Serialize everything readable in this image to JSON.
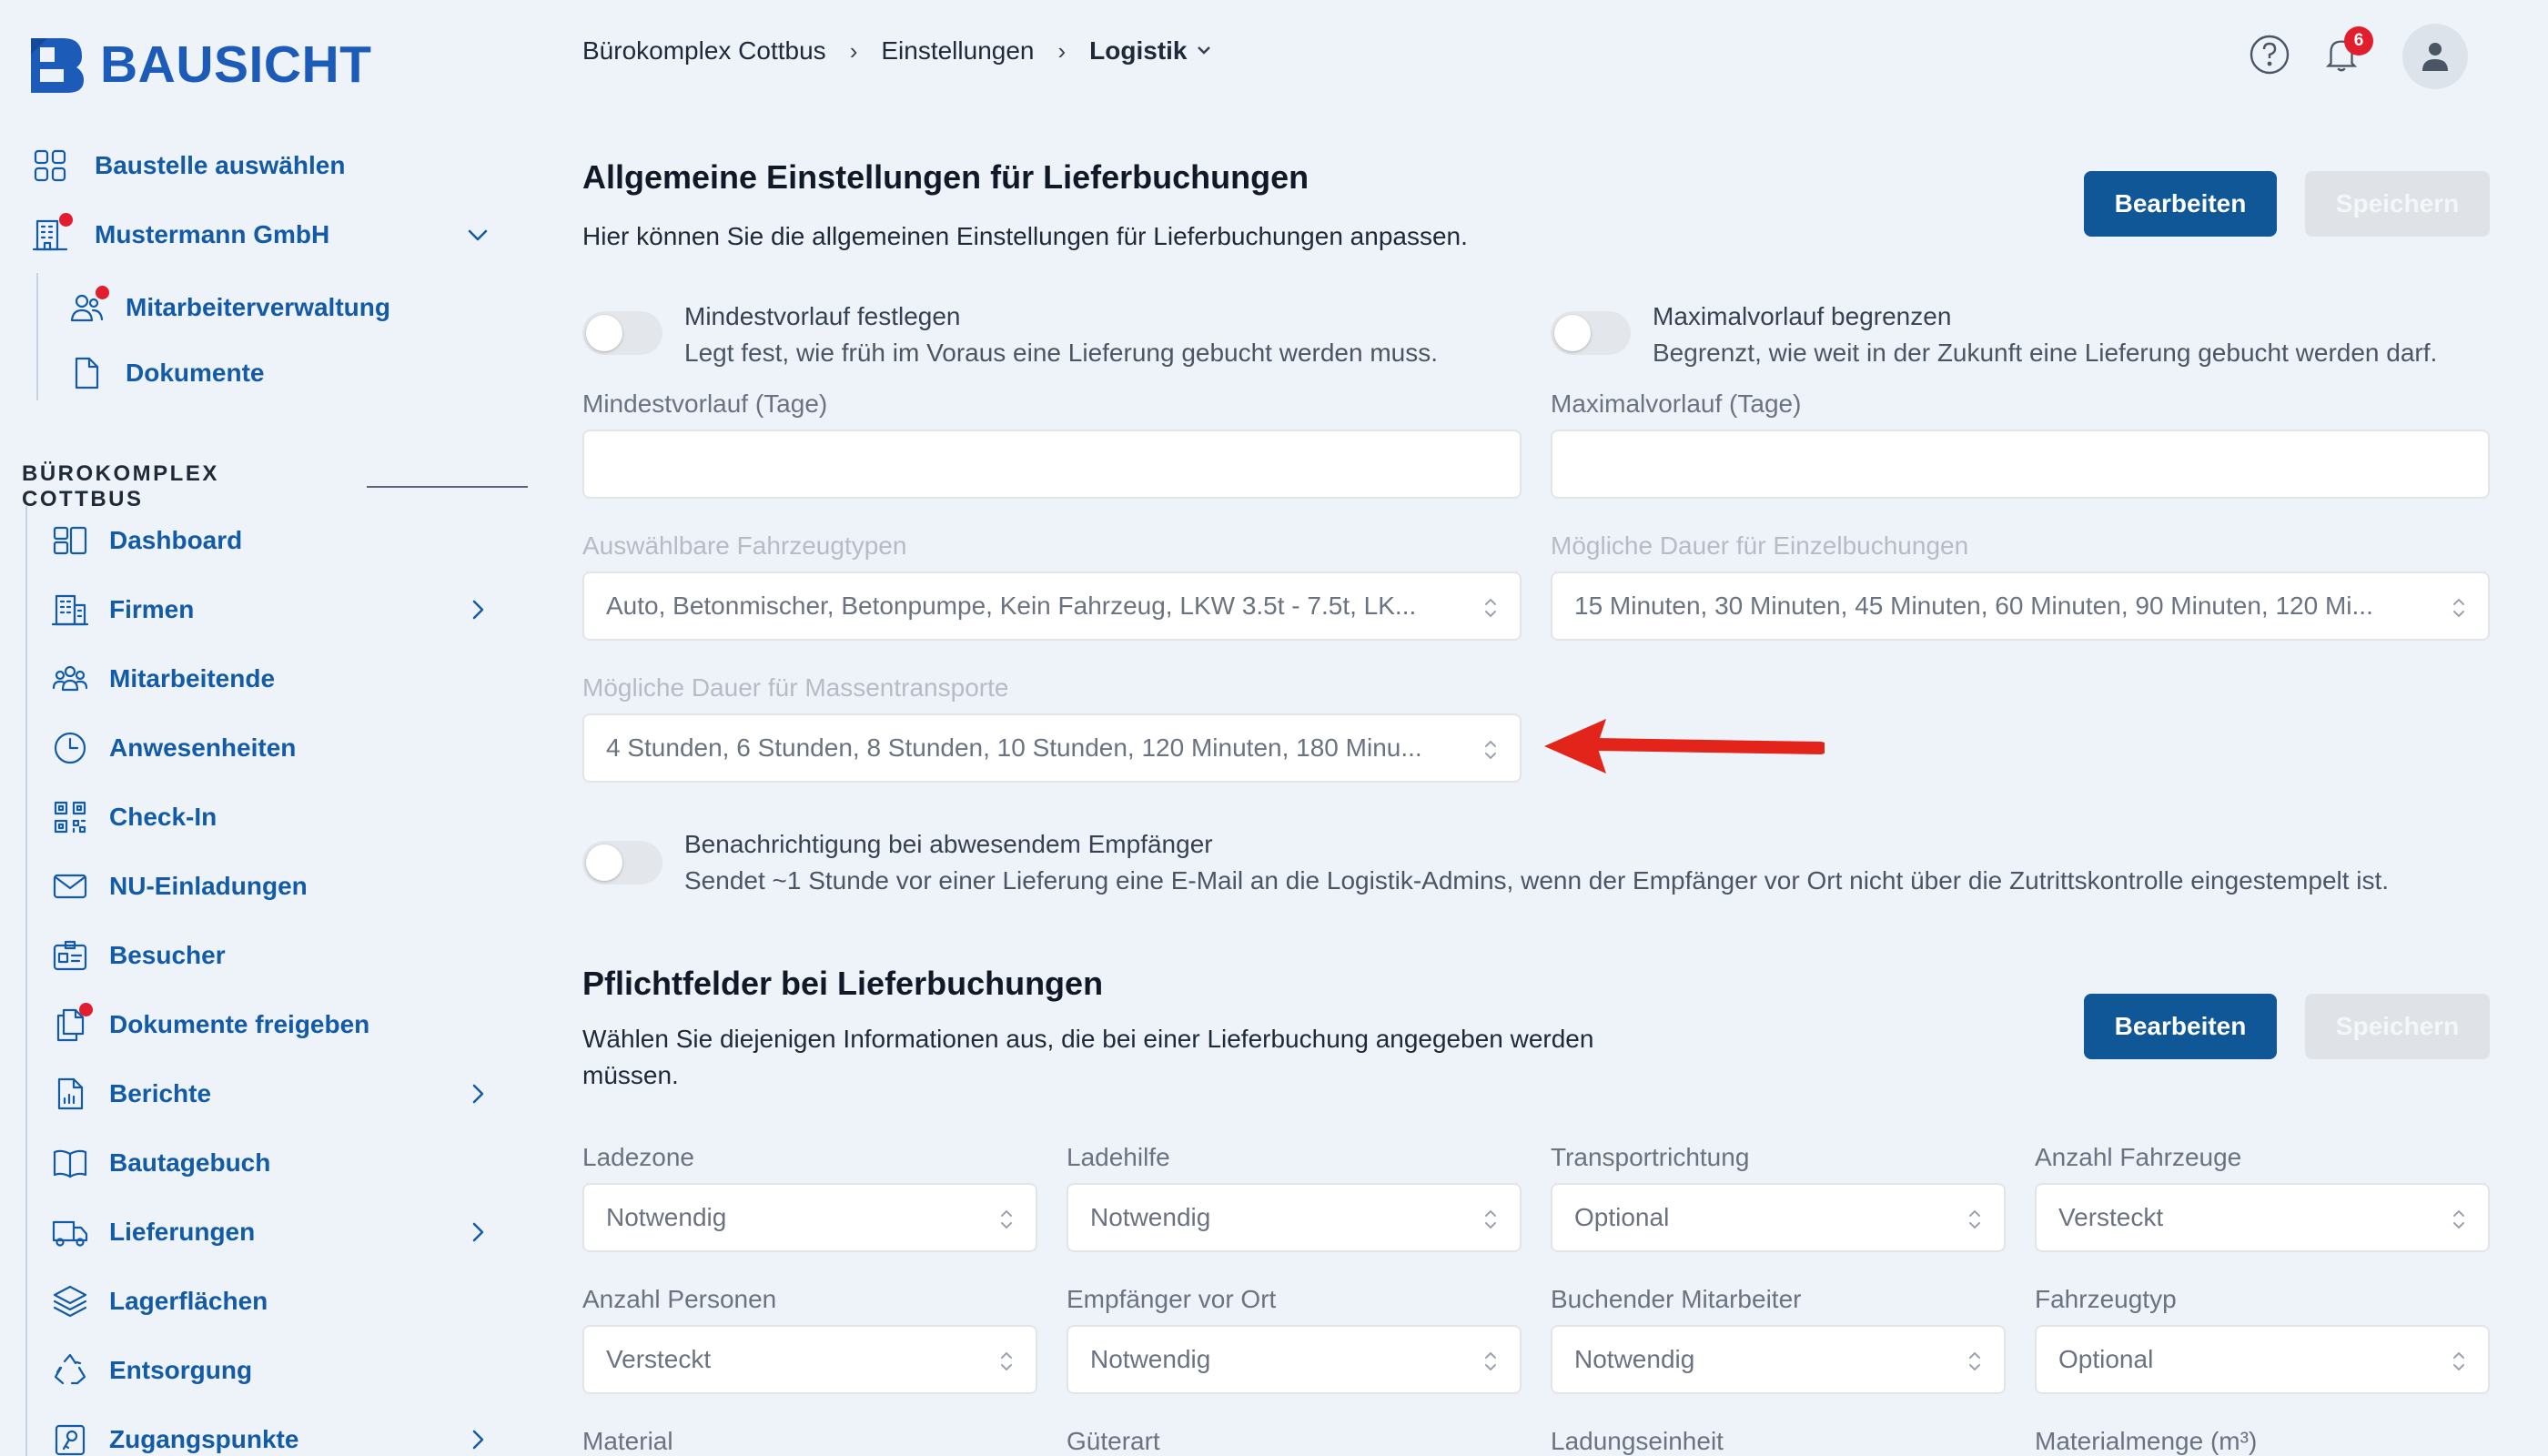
{
  "app": {
    "name": "BAUSICHT"
  },
  "colors": {
    "primary": "#0f5796",
    "accent": "#135ba7",
    "notification": "#e11d2e"
  },
  "sidebar": {
    "top_items": [
      {
        "label": "Baustelle auswählen",
        "icon": "grid-icon"
      },
      {
        "label": "Mustermann GmbH",
        "icon": "building-icon",
        "dot": true,
        "expanded": true
      },
      {
        "label": "Mitarbeiterverwaltung",
        "icon": "users-icon",
        "dot": true
      },
      {
        "label": "Dokumente",
        "icon": "document-icon"
      }
    ],
    "section_title": "BÜROKOMPLEX COTTBUS",
    "items": [
      {
        "label": "Dashboard",
        "icon": "dashboard-icon"
      },
      {
        "label": "Firmen",
        "icon": "company-icon",
        "submenu": true
      },
      {
        "label": "Mitarbeitende",
        "icon": "team-icon"
      },
      {
        "label": "Anwesenheiten",
        "icon": "clock-icon"
      },
      {
        "label": "Check-In",
        "icon": "qr-code-icon"
      },
      {
        "label": "NU-Einladungen",
        "icon": "mail-icon"
      },
      {
        "label": "Besucher",
        "icon": "visitor-badge-icon"
      },
      {
        "label": "Dokumente freigeben",
        "icon": "documents-icon",
        "dot": true
      },
      {
        "label": "Berichte",
        "icon": "report-icon",
        "submenu": true
      },
      {
        "label": "Bautagebuch",
        "icon": "book-icon"
      },
      {
        "label": "Lieferungen",
        "icon": "truck-icon",
        "submenu": true
      },
      {
        "label": "Lagerflächen",
        "icon": "layers-icon"
      },
      {
        "label": "Entsorgung",
        "icon": "recycle-icon"
      },
      {
        "label": "Zugangspunkte",
        "icon": "access-point-icon",
        "submenu": true
      }
    ]
  },
  "header": {
    "breadcrumb": [
      "Bürokomplex Cottbus",
      "Einstellungen",
      "Logistik"
    ],
    "breadcrumb_sep": "›",
    "notifications_count": "6"
  },
  "general": {
    "title": "Allgemeine Einstellungen für Lieferbuchungen",
    "description": "Hier können Sie die allgemeinen Einstellungen für Lieferbuchungen anpassen.",
    "edit_label": "Bearbeiten",
    "save_label": "Speichern",
    "min_toggle": {
      "title": "Mindestvorlauf festlegen",
      "desc": "Legt fest, wie früh im Voraus eine Lieferung gebucht werden muss.",
      "on": false
    },
    "max_toggle": {
      "title": "Maximalvorlauf begrenzen",
      "desc": "Begrenzt, wie weit in der Zukunft eine Lieferung gebucht werden darf.",
      "on": false
    },
    "min_days_label": "Mindestvorlauf (Tage)",
    "min_days_value": "",
    "max_days_label": "Maximalvorlauf (Tage)",
    "max_days_value": "",
    "vehicle_types_label": "Auswählbare Fahrzeugtypen",
    "vehicle_types_value": "Auto, Betonmischer, Betonpumpe, Kein Fahrzeug, LKW 3.5t - 7.5t, LK...",
    "single_duration_label": "Mögliche Dauer für Einzelbuchungen",
    "single_duration_value": "15 Minuten, 30 Minuten, 45 Minuten, 60 Minuten, 90 Minuten, 120 Mi...",
    "mass_duration_label": "Mögliche Dauer für Massentransporte",
    "mass_duration_value": "4 Stunden, 6 Stunden, 8 Stunden, 10 Stunden, 120 Minuten, 180 Minu...",
    "notify_toggle": {
      "title": "Benachrichtigung bei abwesendem Empfänger",
      "desc": "Sendet ~1 Stunde vor einer Lieferung eine E-Mail an die Logistik-Admins, wenn der Empfänger vor Ort nicht über die Zutrittskontrolle eingestempelt ist.",
      "on": false
    }
  },
  "required": {
    "title": "Pflichtfelder bei Lieferbuchungen",
    "description": "Wählen Sie diejenigen Informationen aus, die bei einer Lieferbuchung angegeben werden müssen.",
    "edit_label": "Bearbeiten",
    "save_label": "Speichern",
    "fields": [
      {
        "label": "Ladezone",
        "value": "Notwendig"
      },
      {
        "label": "Ladehilfe",
        "value": "Notwendig"
      },
      {
        "label": "Transportrichtung",
        "value": "Optional"
      },
      {
        "label": "Anzahl Fahrzeuge",
        "value": "Versteckt"
      },
      {
        "label": "Anzahl Personen",
        "value": "Versteckt"
      },
      {
        "label": "Empfänger vor Ort",
        "value": "Notwendig"
      },
      {
        "label": "Buchender Mitarbeiter",
        "value": "Notwendig"
      },
      {
        "label": "Fahrzeugtyp",
        "value": "Optional"
      },
      {
        "label": "Material",
        "value": ""
      },
      {
        "label": "Güterart",
        "value": ""
      },
      {
        "label": "Ladungseinheit",
        "value": ""
      },
      {
        "label": "Materialmenge (m³)",
        "value": ""
      }
    ]
  }
}
